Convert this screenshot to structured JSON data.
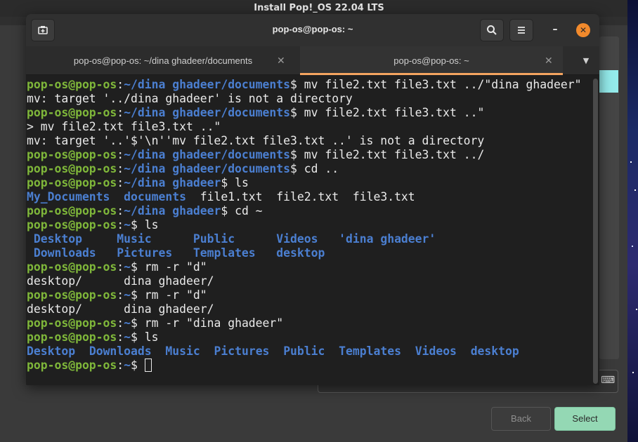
{
  "installer": {
    "title": "Install Pop!_OS 22.04 LTS",
    "back_label": "Back",
    "select_label": "Select",
    "keyboard_icon": "keyboard-icon"
  },
  "terminal": {
    "title": "pop-os@pop-os: ~",
    "new_tab_icon": "new-tab-icon",
    "search_icon": "search-icon",
    "menu_icon": "hamburger-menu-icon",
    "tabs": [
      {
        "label": "pop-os@pop-os: ~/dina ghadeer/documents",
        "active": false
      },
      {
        "label": "pop-os@pop-os: ~",
        "active": true
      }
    ],
    "prompt_user": "pop-os@pop-os",
    "lines": [
      {
        "type": "prompt",
        "path": "~/dina ghadeer/documents",
        "cmd": " mv file2.txt file3.txt ../\"dina ghadeer\""
      },
      {
        "type": "out",
        "text": "mv: target '../dina ghadeer' is not a directory"
      },
      {
        "type": "prompt",
        "path": "~/dina ghadeer/documents",
        "cmd": " mv file2.txt file3.txt ..\""
      },
      {
        "type": "out",
        "text": "> mv file2.txt file3.txt ..\""
      },
      {
        "type": "out",
        "text": "mv: target '..'$'\\n''mv file2.txt file3.txt ..' is not a directory"
      },
      {
        "type": "prompt",
        "path": "~/dina ghadeer/documents",
        "cmd": " mv file2.txt file3.txt ../"
      },
      {
        "type": "prompt",
        "path": "~/dina ghadeer/documents",
        "cmd": " cd .."
      },
      {
        "type": "prompt",
        "path": "~/dina ghadeer",
        "cmd": " ls"
      },
      {
        "type": "ls",
        "items": [
          {
            "text": "My_Documents",
            "dir": true,
            "gap": "  "
          },
          {
            "text": "documents",
            "dir": true,
            "gap": "  "
          },
          {
            "text": "file1.txt",
            "dir": false,
            "gap": "  "
          },
          {
            "text": "file2.txt",
            "dir": false,
            "gap": "  "
          },
          {
            "text": "file3.txt",
            "dir": false,
            "gap": ""
          }
        ]
      },
      {
        "type": "prompt",
        "path": "~/dina ghadeer",
        "cmd": " cd ~"
      },
      {
        "type": "prompt",
        "path": "~",
        "cmd": " ls"
      },
      {
        "type": "ls",
        "items": [
          {
            "text": " Desktop",
            "dir": true,
            "gap": "     "
          },
          {
            "text": "Music",
            "dir": true,
            "gap": "      "
          },
          {
            "text": "Public",
            "dir": true,
            "gap": "      "
          },
          {
            "text": "Videos",
            "dir": true,
            "gap": "   "
          },
          {
            "text": "'dina ghadeer'",
            "dir": true,
            "gap": ""
          }
        ]
      },
      {
        "type": "ls",
        "items": [
          {
            "text": " Downloads",
            "dir": true,
            "gap": "   "
          },
          {
            "text": "Pictures",
            "dir": true,
            "gap": "   "
          },
          {
            "text": "Templates",
            "dir": true,
            "gap": "   "
          },
          {
            "text": "desktop",
            "dir": true,
            "gap": ""
          }
        ]
      },
      {
        "type": "prompt",
        "path": "~",
        "cmd": " rm -r \"d\""
      },
      {
        "type": "out",
        "text": "desktop/      dina ghadeer/"
      },
      {
        "type": "prompt",
        "path": "~",
        "cmd": " rm -r \"d\""
      },
      {
        "type": "out",
        "text": "desktop/      dina ghadeer/"
      },
      {
        "type": "prompt",
        "path": "~",
        "cmd": " rm -r \"dina ghadeer\""
      },
      {
        "type": "prompt",
        "path": "~",
        "cmd": " ls"
      },
      {
        "type": "ls",
        "items": [
          {
            "text": "Desktop",
            "dir": true,
            "gap": "  "
          },
          {
            "text": "Downloads",
            "dir": true,
            "gap": "  "
          },
          {
            "text": "Music",
            "dir": true,
            "gap": "  "
          },
          {
            "text": "Pictures",
            "dir": true,
            "gap": "  "
          },
          {
            "text": "Public",
            "dir": true,
            "gap": "  "
          },
          {
            "text": "Templates",
            "dir": true,
            "gap": "  "
          },
          {
            "text": "Videos",
            "dir": true,
            "gap": "  "
          },
          {
            "text": "desktop",
            "dir": true,
            "gap": ""
          }
        ]
      },
      {
        "type": "prompt",
        "path": "~",
        "cmd": " ",
        "cursor": true
      }
    ]
  },
  "colors": {
    "prompt_user": "#7fb73a",
    "path": "#4b7fd1",
    "accent_tab": "#f4a460",
    "close_button": "#f28a2c",
    "select_button": "#94d8b4"
  }
}
